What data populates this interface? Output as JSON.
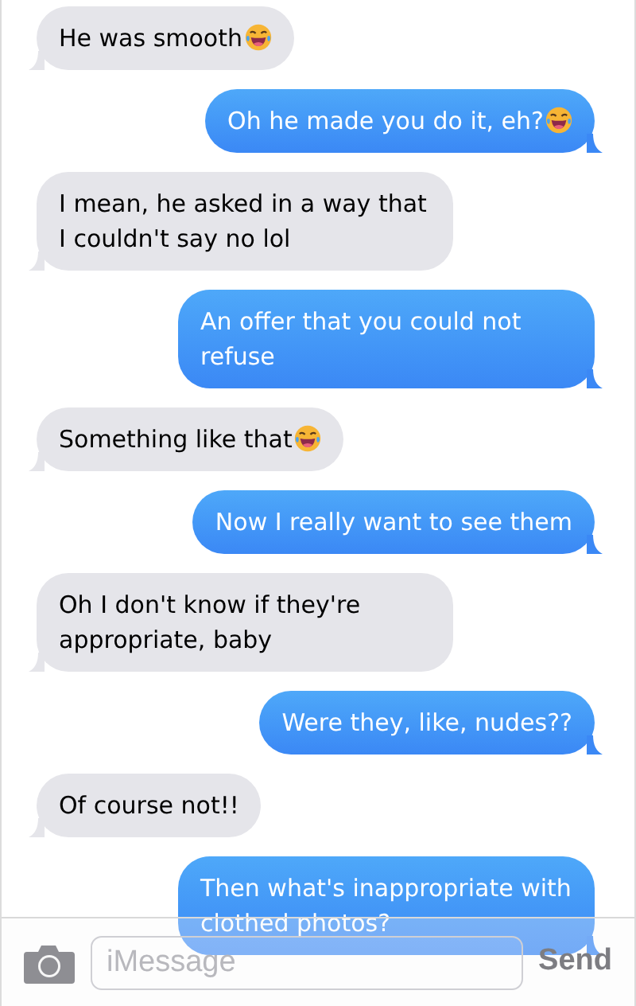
{
  "messages": [
    {
      "kind": "received",
      "text": "He was smooth",
      "emoji": true
    },
    {
      "kind": "sent",
      "text": "Oh he made you do it, eh?",
      "emoji": true
    },
    {
      "kind": "received",
      "text": "I mean, he asked in a way that I couldn't say no lol",
      "emoji": false
    },
    {
      "kind": "sent",
      "text": "An offer that you could not refuse",
      "emoji": false
    },
    {
      "kind": "received",
      "text": "Something like that",
      "emoji": true
    },
    {
      "kind": "sent",
      "text": "Now I really want to see them",
      "emoji": false
    },
    {
      "kind": "received",
      "text": "Oh I don't know if they're appropriate, baby",
      "emoji": false
    },
    {
      "kind": "sent",
      "text": "Were they, like, nudes??",
      "emoji": false
    },
    {
      "kind": "received",
      "text": "Of course not!!",
      "emoji": false
    },
    {
      "kind": "sent",
      "text": "Then what's inappropriate with clothed photos?",
      "emoji": false
    }
  ],
  "composer": {
    "placeholder": "iMessage",
    "send": "Send"
  }
}
